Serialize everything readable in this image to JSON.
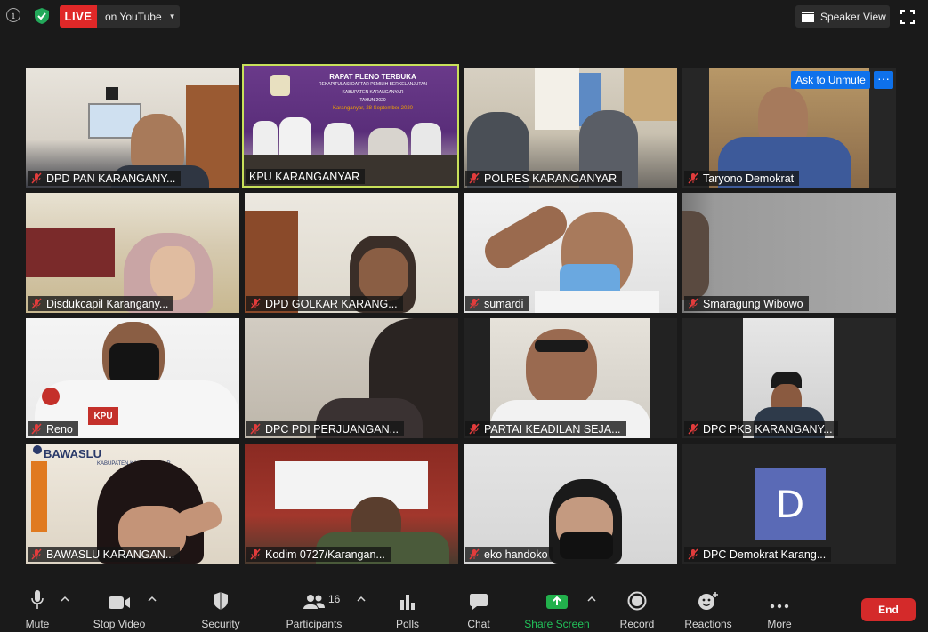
{
  "topbar": {
    "live_badge": "LIVE",
    "live_target": "on YouTube",
    "view_label": "Speaker View"
  },
  "participants": [
    {
      "name": "DPD PAN KARANGANY..."
    },
    {
      "name": "KPU KARANGANYAR"
    },
    {
      "name": "POLRES KARANGANYAR"
    },
    {
      "name": "Taryono Demokrat"
    },
    {
      "name": "Disdukcapil Karangany..."
    },
    {
      "name": "DPD GOLKAR KARANG..."
    },
    {
      "name": "sumardi"
    },
    {
      "name": "Smaragung Wibowo"
    },
    {
      "name": "Reno"
    },
    {
      "name": "DPC PDI PERJUANGAN..."
    },
    {
      "name": "PARTAI KEADILAN SEJA..."
    },
    {
      "name": "DPC PKB KARANGANY..."
    },
    {
      "name": "BAWASLU KARANGAN..."
    },
    {
      "name": "Kodim 0727/Karangan..."
    },
    {
      "name": "eko handoko"
    },
    {
      "name": "DPC Demokrat Karang..."
    }
  ],
  "kpu_banner": {
    "line1": "RAPAT PLENO TERBUKA",
    "line2": "REKAPITULASI DAFTAR PEMILIH BERKELANJUTAN",
    "line3": "KABUPATEN KARANGANYAR",
    "line4": "TAHUN 2020",
    "line5": "Karanganyar, 28 September 2020"
  },
  "bawaslu_sign": "BAWASLU",
  "bawaslu_sub": "KABUPATEN KARANGANYAR",
  "kpu_badge": "KPU",
  "avatar_letter": "D",
  "overlay": {
    "ask_to_unmute": "Ask to Unmute",
    "more": "···"
  },
  "toolbar": {
    "mute": "Mute",
    "stop_video": "Stop Video",
    "security": "Security",
    "participants": "Participants",
    "participants_count": "16",
    "polls": "Polls",
    "chat": "Chat",
    "share_screen": "Share Screen",
    "record": "Record",
    "reactions": "Reactions",
    "more": "More",
    "end": "End"
  },
  "colors": {
    "background": "#1a1a1a",
    "live_red": "#e02828",
    "active_speaker": "#c8e05a",
    "zoom_blue": "#0e71eb",
    "share_green": "#22b14c",
    "end_red": "#d42a2a",
    "avatar_purple": "#5a6ab6"
  }
}
